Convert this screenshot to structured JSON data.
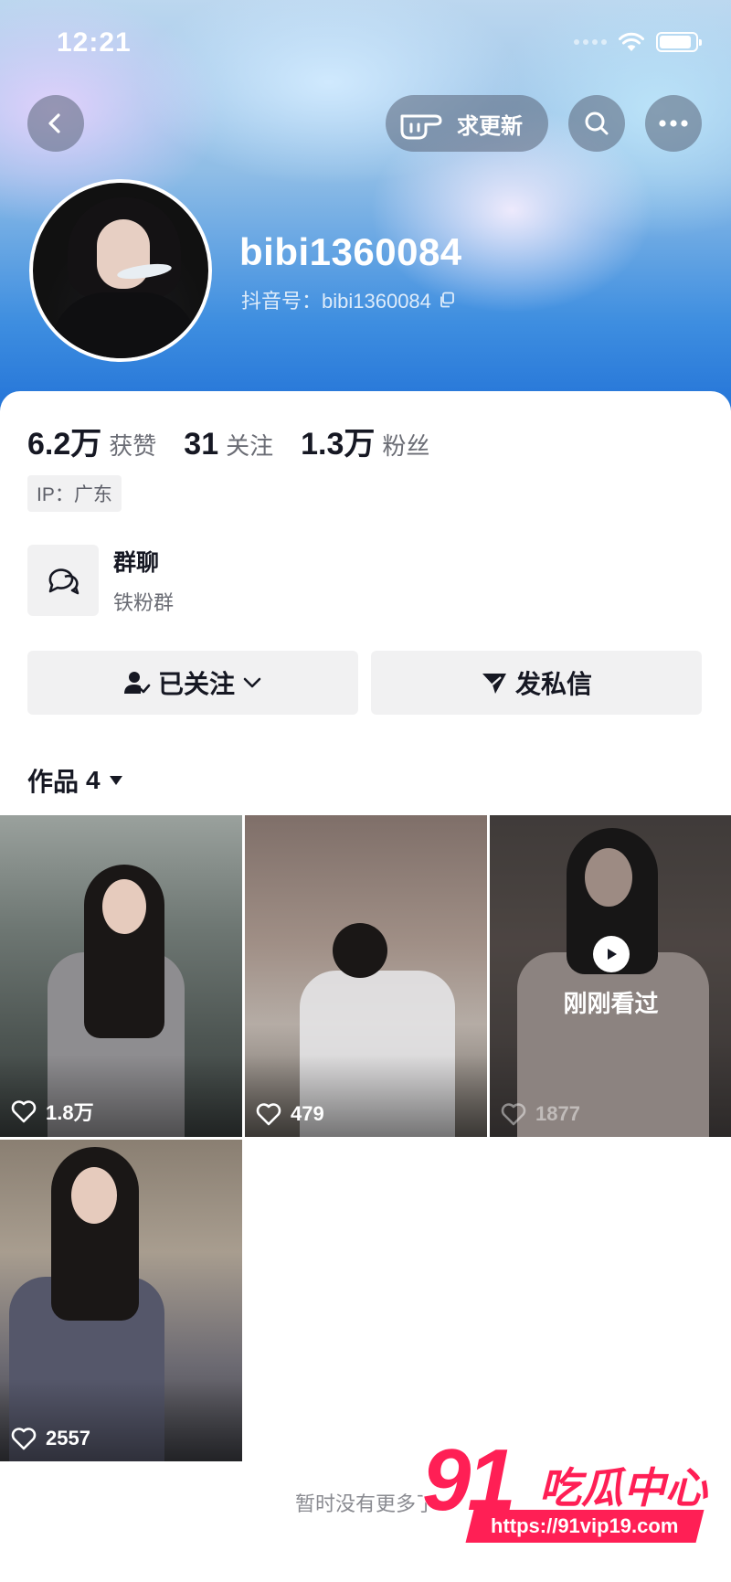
{
  "status_bar": {
    "time": "12:21"
  },
  "header": {
    "update_label": "求更新",
    "username": "bibi1360084",
    "douyin_id": "抖音号：bibi1360084"
  },
  "stats": [
    {
      "value": "6.2万",
      "label": "获赞"
    },
    {
      "value": "31",
      "label": "关注"
    },
    {
      "value": "1.3万",
      "label": "粉丝"
    }
  ],
  "ip_tag": "IP：广东",
  "group": {
    "title": "群聊",
    "subtitle": "铁粉群"
  },
  "actions": {
    "follow_label": "已关注",
    "dm_label": "发私信"
  },
  "works": {
    "label": "作品",
    "count": "4",
    "items": [
      {
        "likes": "1.8万"
      },
      {
        "likes": "479"
      },
      {
        "likes": "1877",
        "overlay": "刚刚看过"
      },
      {
        "likes": "2557"
      }
    ]
  },
  "footer": {
    "no_more": "暂时没有更多了"
  },
  "watermark": {
    "logo": "91吃瓜中心",
    "url": "https://91vip19.com"
  },
  "colors": {
    "accent": "#ff1f55",
    "hero_blue": "#1f6fd6",
    "button_bg": "#f1f1f2"
  }
}
